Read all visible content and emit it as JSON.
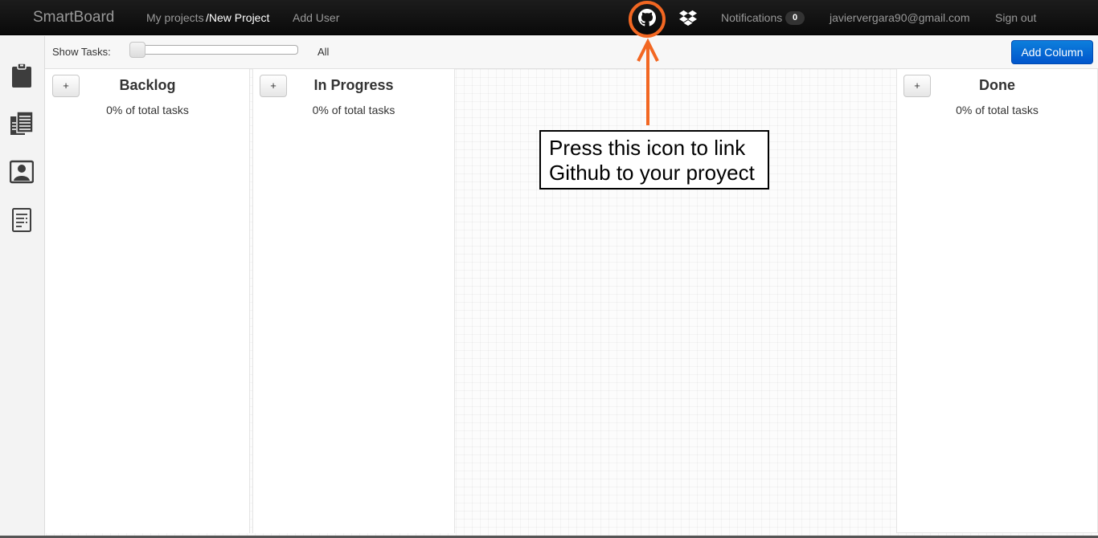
{
  "navbar": {
    "brand": "SmartBoard",
    "breadcrumb_projects": "My projects",
    "breadcrumb_current": "/New Project",
    "add_user": "Add User",
    "notifications_label": "Notifications",
    "notifications_count": "0",
    "user_email": "javiervergara90@gmail.com",
    "sign_out": "Sign out",
    "icons": [
      "github-icon",
      "dropbox-icon"
    ]
  },
  "sidebar": {
    "icons": [
      "clipboard-icon",
      "documents-icon",
      "user-profile-icon",
      "report-icon"
    ]
  },
  "toolbar": {
    "show_tasks_label": "Show Tasks:",
    "show_tasks_value": "All",
    "add_column_label": "Add Column"
  },
  "columns": [
    {
      "add_label": "+",
      "title": "Backlog",
      "subtitle": "0% of total tasks"
    },
    {
      "add_label": "+",
      "title": "In Progress",
      "subtitle": "0% of total tasks"
    },
    {
      "add_label": "+",
      "title": "Done",
      "subtitle": "0% of total tasks"
    }
  ],
  "annotation": {
    "line1": "Press this icon to link",
    "line2": "Github to your proyect",
    "accent_color": "#f26722"
  },
  "colors": {
    "navbar_bg": "#111111",
    "primary_button": "#0069d6"
  }
}
